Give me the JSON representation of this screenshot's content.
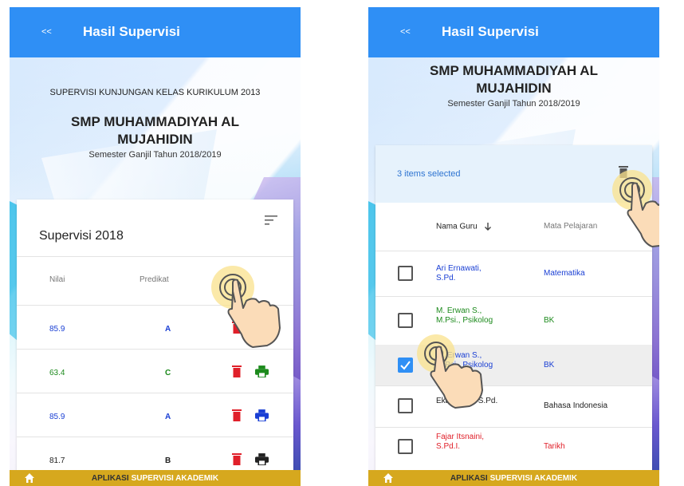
{
  "left": {
    "appbar": {
      "back": "<<",
      "title": "Hasil Supervisi"
    },
    "header": {
      "subtitle": "SUPERVISI KUNJUNGAN KELAS KURIKULUM 2013",
      "school_line1": "SMP MUHAMMADIYAH AL",
      "school_line2": "MUJAHIDIN",
      "semester": "Semester Ganjil Tahun 2018/2019"
    },
    "card": {
      "title": "Supervisi 2018",
      "columns": {
        "nilai": "Nilai",
        "predikat": "Predikat"
      },
      "rows": [
        {
          "nilai": "85.9",
          "predikat": "A",
          "color": "#1a3fd4",
          "print_color": "#c9a7d3"
        },
        {
          "nilai": "63.4",
          "predikat": "C",
          "color": "#1c8a1c",
          "print_color": "#1c8a1c"
        },
        {
          "nilai": "85.9",
          "predikat": "A",
          "color": "#1a3fd4",
          "print_color": "#1a3fd4"
        },
        {
          "nilai": "81.7",
          "predikat": "B",
          "color": "#222222",
          "print_color": "#222222"
        }
      ]
    },
    "footer": {
      "prefix": "APLIKASI",
      "accent": "SUPERVISI AKADEMIK"
    }
  },
  "right": {
    "appbar": {
      "back": "<<",
      "title": "Hasil Supervisi"
    },
    "header": {
      "school_line1": "SMP MUHAMMADIYAH AL",
      "school_line2": "MUJAHIDIN",
      "semester": "Semester Ganjil Tahun 2018/2019"
    },
    "card": {
      "selected_text": "3 items selected",
      "columns": {
        "nama": "Nama Guru",
        "mapel": "Mata Pelajaran"
      },
      "rows": [
        {
          "nama": "Ari Ernawati, S.Pd.",
          "mapel": "Matematika",
          "color": "#1a3fd4",
          "checked": false
        },
        {
          "nama": "M. Erwan S., M.Psi., Psikolog",
          "mapel": "BK",
          "color": "#1c8a1c",
          "checked": false
        },
        {
          "nama": "M. Erwan S., M.Psi., Psikolog",
          "mapel": "BK",
          "color": "#1a3fd4",
          "checked": true
        },
        {
          "nama": "Eka Susila, S.Pd.",
          "mapel": "Bahasa Indonesia",
          "color": "#222222",
          "checked": false
        },
        {
          "nama": "Fajar Itsnaini, S.Pd.I.",
          "mapel": "Tarikh",
          "color": "#e0202a",
          "checked": false
        }
      ]
    },
    "footer": {
      "prefix": "APLIKASI",
      "accent": "SUPERVISI AKADEMIK"
    }
  },
  "icons": {
    "filter": "filter-icon",
    "delete": "trash-icon",
    "print": "printer-icon",
    "home": "home-icon",
    "sort": "arrow-down-icon",
    "hand": "tap-hand-icon"
  }
}
